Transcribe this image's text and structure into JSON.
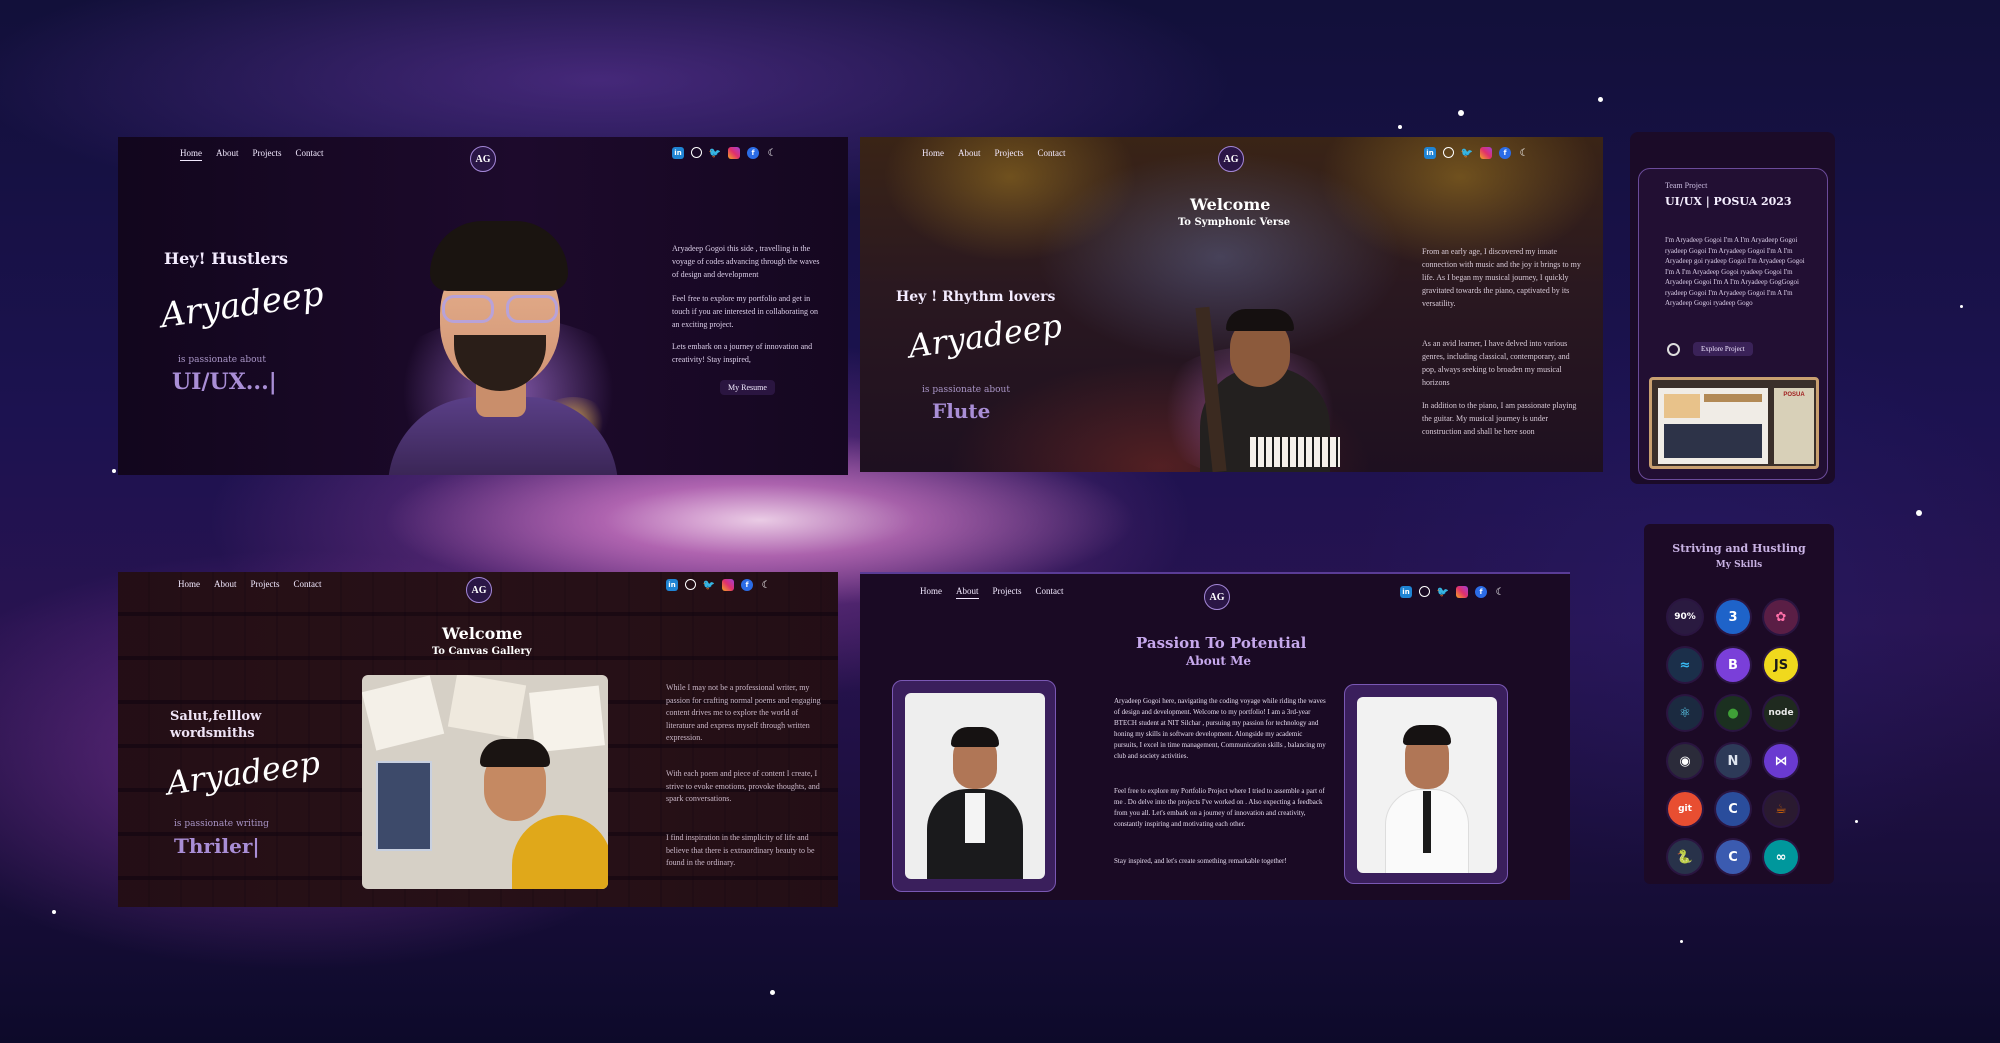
{
  "nav": {
    "home": "Home",
    "about": "About",
    "projects": "Projects",
    "contact": "Contact",
    "logo": "AG"
  },
  "socials": {
    "linkedin": "in",
    "github": "",
    "twitter": "🐦",
    "instagram": "",
    "facebook": "f",
    "theme": "☾"
  },
  "signature": "Aryadeep",
  "panel1": {
    "greeting": "Hey! Hustlers",
    "passion_label": "is passionate about",
    "role": "UI/UX...|",
    "intro": "Aryadeep Gogoi this side , travelling in the voyage of codes advancing through the waves of design and development",
    "para2": "Feel free to explore my portfolio and get in touch if you are interested in collaborating on an exciting project.",
    "para3": "Lets embark on a journey of innovation and creativity! Stay inspired,",
    "resume_button": "My Resume"
  },
  "panel2": {
    "welcome": "Welcome",
    "subtitle": "To Symphonic Verse",
    "greeting": "Hey ! Rhythm lovers",
    "passion_label": "is passionate about",
    "instrument": "Flute",
    "para1": "From an early age, I discovered my innate connection with music and the joy it brings to my life. As I began my musical journey, I quickly gravitated towards the piano, captivated by its versatility.",
    "para2": "As an avid learner, I have delved into various genres, including classical, contemporary, and pop, always seeking to broaden my musical horizons",
    "para3": "In addition to the piano, I am passionate playing the guitar. My musical journey is under construction and shall be here soon"
  },
  "panel3": {
    "welcome": "Welcome",
    "subtitle": "To Canvas Gallery",
    "greeting": "Salut,felllow wordsmiths",
    "passion_label": "is passionate writing",
    "genre": "Thriler|",
    "para1": "While I may not be a professional writer, my passion for crafting normal poems and engaging content drives me to explore the world of literature and express myself through written expression.",
    "para2": "With each poem and piece of content I create, I strive to evoke emotions, provoke thoughts, and spark conversations.",
    "para3": "I find inspiration in the simplicity of life and believe that there is extraordinary beauty to be found in the ordinary."
  },
  "panel4": {
    "title": "Passion To Potential",
    "subtitle": "About Me",
    "para1": "Aryadeep Gogoi here, navigating the coding voyage while riding the waves of design and development. Welcome to my portfolio! I am a 3rd-year BTECH student at NIT Silchar , pursuing my passion for technology and honing my skills in software development. Alongside my academic pursuits, I excel in time management, Communication skills , balancing my club and society activities.",
    "para2": "Feel free to explore my Portfolio Project where I tried to assemble a part of me . Do delve into the projects I've worked on . Also expecting a feedback from you all. Let's embark on a journey of innovation and creativity, constantly inspiring and motivating each other.",
    "para3": "Stay inspired, and let's create something remarkable together!"
  },
  "project_card": {
    "label": "Team Project",
    "title": "UI/UX | POSUA 2023",
    "description": "I'm Aryadeep Gogoi I'm A I'm Aryadeep Gogoi ryadeep Gogoi I'm Aryadeep Gogoi I'm A I'm Aryadeep goi ryadeep Gogoi I'm Aryadeep Gogoi I'm A I'm Aryadeep Gogoi ryadeep Gogoi I'm Aryadeep Gogoi I'm A I'm Aryadeep GogGogoi ryadeep Gogoi I'm Aryadeep Gogoi I'm A I'm Aryadeep Gogoi ryadeep Gogo",
    "button": "Explore Project",
    "preview_badge": "POSUA"
  },
  "skills": {
    "title": "Striving and Hustling",
    "subtitle": "My Skills",
    "items": [
      {
        "label": "90%",
        "color": "#ffffff",
        "bg": "#2a1a40"
      },
      {
        "label": "3",
        "color": "#ffffff",
        "bg": "#1e63c9"
      },
      {
        "label": "✿",
        "color": "#ff6fa8",
        "bg": "#5a1e45"
      },
      {
        "label": "≈",
        "color": "#38bdf8",
        "bg": "#1b2f4a"
      },
      {
        "label": "B",
        "color": "#ffffff",
        "bg": "#7a3fd9"
      },
      {
        "label": "JS",
        "color": "#1a1a1a",
        "bg": "#f0d91d"
      },
      {
        "label": "⚛",
        "color": "#61dafb",
        "bg": "#1b2a40"
      },
      {
        "label": "●",
        "color": "#3fa037",
        "bg": "#1b3020"
      },
      {
        "label": "node",
        "color": "#e8e8e8",
        "bg": "#1f2a1f"
      },
      {
        "label": "◉",
        "color": "#ffffff",
        "bg": "#2b2b3a"
      },
      {
        "label": "N",
        "color": "#dfe6f0",
        "bg": "#2d3a58"
      },
      {
        "label": "⋈",
        "color": "#ffffff",
        "bg": "#6a3ad0"
      },
      {
        "label": "git",
        "color": "#ffffff",
        "bg": "#e84e31"
      },
      {
        "label": "C",
        "color": "#ffffff",
        "bg": "#2a4d9c"
      },
      {
        "label": "☕",
        "color": "#e76f00",
        "bg": "#2a1a30"
      },
      {
        "label": "🐍",
        "color": "#ffd43b",
        "bg": "#28324a"
      },
      {
        "label": "C",
        "color": "#ffffff",
        "bg": "#3b5bb0"
      },
      {
        "label": "∞",
        "color": "#ffffff",
        "bg": "#00979c"
      }
    ]
  }
}
